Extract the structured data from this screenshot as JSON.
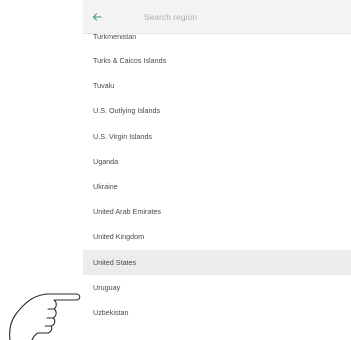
{
  "search": {
    "placeholder": "Search region",
    "value": ""
  },
  "icons": {
    "back": "arrow-left-icon",
    "cursor": "pointing-hand-icon"
  },
  "colors": {
    "back_arrow": "#2f9e8f",
    "selected_row": "#ececec",
    "search_bar": "#f3f3f3"
  },
  "regions": [
    "Turkmenistan",
    "Turks & Caicos Islands",
    "Tuvalu",
    "U.S. Outlying Islands",
    "U.S. Virgin Islands",
    "Uganda",
    "Ukraine",
    "United Arab Emirates",
    "United Kingdom",
    "United States",
    "Uruguay",
    "Uzbekistan"
  ],
  "selected_region": "United States"
}
